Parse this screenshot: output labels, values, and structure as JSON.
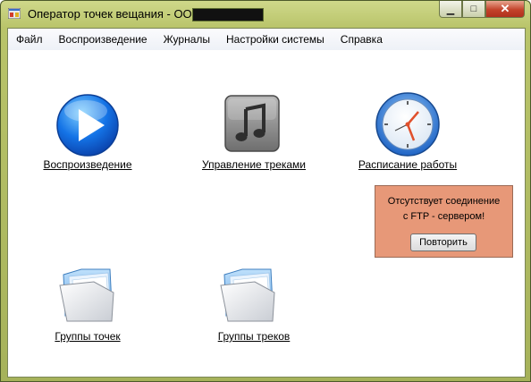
{
  "window": {
    "title": "Оператор точек вещания - ООО",
    "minimize_glyph": "▁",
    "maximize_glyph": "□",
    "close_glyph": "✕"
  },
  "menu": {
    "items": [
      {
        "label": "Файл"
      },
      {
        "label": "Воспроизведение"
      },
      {
        "label": "Журналы"
      },
      {
        "label": "Настройки системы"
      },
      {
        "label": "Справка"
      }
    ]
  },
  "tiles": {
    "playback": {
      "label": "Воспроизведение",
      "icon": "play-icon"
    },
    "tracks": {
      "label": "Управление треками",
      "icon": "music-note-icon"
    },
    "schedule": {
      "label": "Расписание работы",
      "icon": "clock-icon"
    },
    "point_groups": {
      "label": "Группы точек",
      "icon": "folder-icon"
    },
    "track_groups": {
      "label": "Группы треков",
      "icon": "folder-icon"
    }
  },
  "ftp_error": {
    "line1": "Отсутствует соединение",
    "line2": "с FTP - сервером!",
    "retry_label": "Повторить",
    "background_color": "#e79878"
  }
}
